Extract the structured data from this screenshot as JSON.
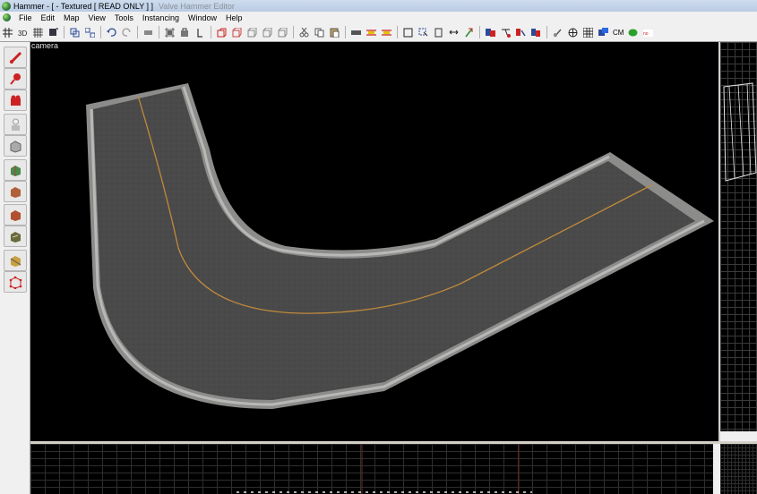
{
  "window": {
    "title": "Hammer - [ - Textured [ READ ONLY ] ]",
    "title_extra": "Valve Hammer Editor"
  },
  "menu": [
    "File",
    "Edit",
    "Map",
    "View",
    "Tools",
    "Instancing",
    "Window",
    "Help"
  ],
  "toolbar": {
    "cm_label": "CM"
  },
  "tools": [
    {
      "name": "selection-tool",
      "icon": "pointer-icon"
    },
    {
      "name": "magnify-tool",
      "icon": "magnify-icon"
    },
    {
      "name": "camera-tool",
      "icon": "camera-icon"
    },
    {
      "name": "entity-tool",
      "icon": "entity-icon"
    },
    {
      "name": "block-tool",
      "icon": "block-icon"
    },
    {
      "name": "texture-application-tool",
      "icon": "texture-icon"
    },
    {
      "name": "apply-current-texture-tool",
      "icon": "apply-texture-icon"
    },
    {
      "name": "decal-tool",
      "icon": "decal-icon"
    },
    {
      "name": "overlay-tool",
      "icon": "overlay-icon"
    },
    {
      "name": "clipping-tool",
      "icon": "clip-icon"
    },
    {
      "name": "vertex-tool",
      "icon": "vertex-icon"
    }
  ],
  "viewports": {
    "camera_label": "camera"
  },
  "colors": {
    "road_asphalt": "#4a4a4a",
    "road_curb": "#9a9a98",
    "center_line": "#c08a3a",
    "grid_line": "#3a3a3a"
  }
}
